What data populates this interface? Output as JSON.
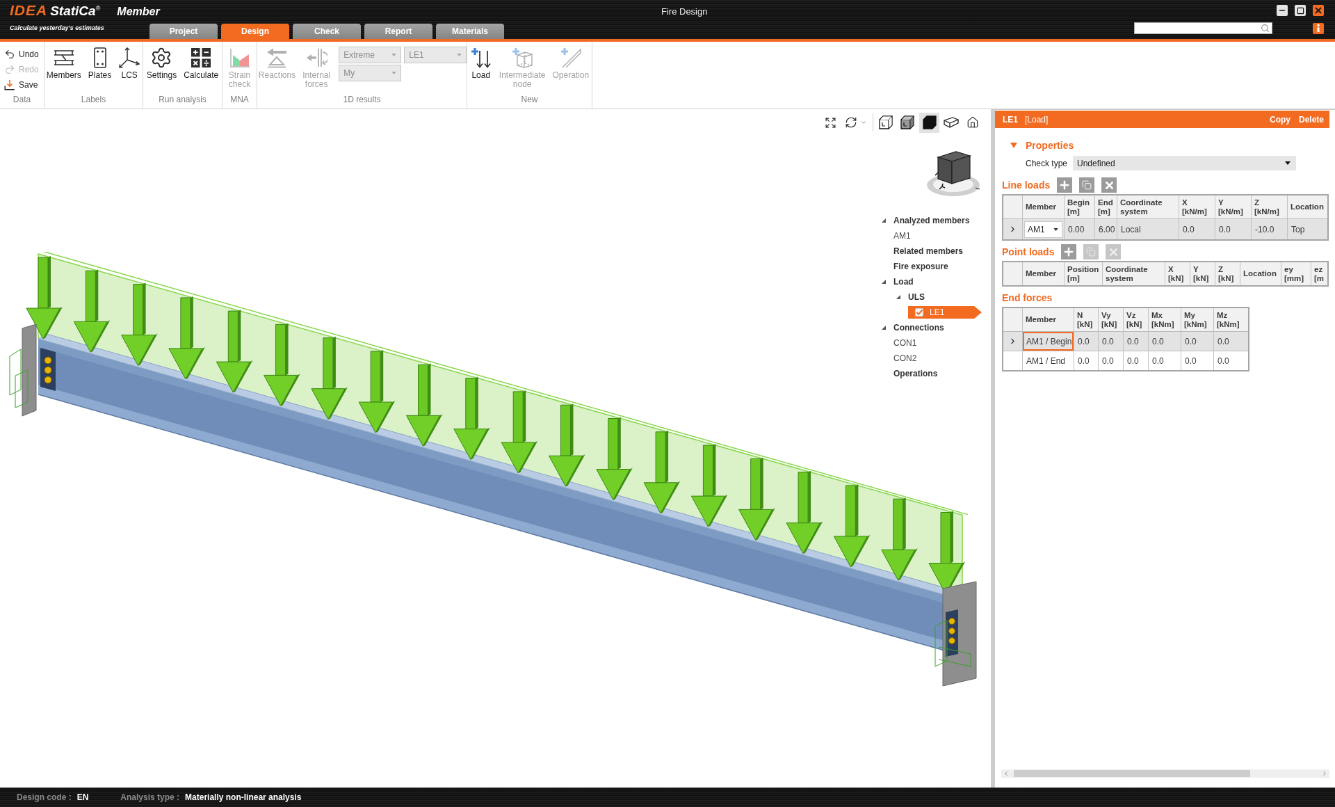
{
  "brand": {
    "mark": "IDEA",
    "name": "StatiCa$^{®}$",
    "product": "Member",
    "tagline": "Calculate yesterday's estimates"
  },
  "window": {
    "title": "Fire Design"
  },
  "tabs": [
    {
      "label": "Project",
      "selected": false
    },
    {
      "label": "Design",
      "selected": true
    },
    {
      "label": "Check",
      "selected": false
    },
    {
      "label": "Report",
      "selected": false
    },
    {
      "label": "Materials",
      "selected": false
    }
  ],
  "ribbon": {
    "groups": [
      {
        "label": "Data",
        "kind": "list",
        "buttons": [
          {
            "kind": "undo",
            "label": "Undo",
            "disabled": false
          },
          {
            "kind": "redo",
            "label": "Redo",
            "disabled": true
          },
          {
            "kind": "save",
            "label": "Save",
            "disabled": false
          }
        ]
      },
      {
        "label": "Labels",
        "kind": "large",
        "buttons": [
          {
            "kind": "members",
            "label": "Members",
            "disabled": false
          },
          {
            "kind": "plates",
            "label": "Plates",
            "disabled": false
          },
          {
            "kind": "lcs",
            "label": "LCS",
            "disabled": false
          }
        ]
      },
      {
        "label": "Run analysis",
        "kind": "large",
        "buttons": [
          {
            "kind": "settings",
            "label": "Settings",
            "disabled": false
          },
          {
            "kind": "calculate",
            "label": "Calculate",
            "disabled": false
          }
        ]
      },
      {
        "label": "MNA",
        "kind": "large",
        "buttons": [
          {
            "kind": "strain",
            "label": "Strain\ncheck",
            "disabled": true
          }
        ]
      },
      {
        "label": "1D results",
        "kind": "large",
        "buttons": [
          {
            "kind": "reactions",
            "label": "Reactions",
            "disabled": true
          },
          {
            "kind": "internal-forces",
            "label": "Internal\nforces",
            "disabled": true
          }
        ],
        "selects": [
          {
            "value": "Extreme",
            "disabled": true
          },
          {
            "value": "LE1",
            "disabled": true
          },
          {
            "value": "My",
            "disabled": true
          }
        ]
      },
      {
        "label": "New",
        "kind": "large",
        "buttons": [
          {
            "kind": "load",
            "label": "Load",
            "disabled": false
          },
          {
            "kind": "node",
            "label": "Intermediate\nnode",
            "disabled": true
          },
          {
            "kind": "operation",
            "label": "Operation",
            "disabled": true
          }
        ]
      }
    ]
  },
  "viewport": {
    "view_tools": [
      {
        "kind": "fit",
        "selected": false
      },
      {
        "kind": "orbit",
        "selected": false
      },
      {
        "kind": "wireframe",
        "selected": false
      },
      {
        "kind": "shaded",
        "selected": false
      },
      {
        "kind": "solid",
        "selected": true
      },
      {
        "kind": "perspective",
        "selected": false
      },
      {
        "kind": "home",
        "selected": false
      }
    ],
    "tree": [
      {
        "label": "Analyzed members",
        "kind": "section",
        "expanded": true,
        "selected": false,
        "children": [
          {
            "label": "AM1",
            "kind": "item",
            "selected": false
          }
        ]
      },
      {
        "label": "Related members",
        "kind": "section",
        "selected": false
      },
      {
        "label": "Fire exposure",
        "kind": "section",
        "selected": false
      },
      {
        "label": "Load",
        "kind": "section",
        "expanded": true,
        "selected": false,
        "children": [
          {
            "label": "ULS",
            "kind": "section",
            "expanded": true,
            "selected": false,
            "children": [
              {
                "label": "LE1",
                "kind": "item",
                "checked": true,
                "selected": true
              }
            ]
          }
        ]
      },
      {
        "label": "Connections",
        "kind": "section",
        "expanded": true,
        "selected": false,
        "children": [
          {
            "label": "CON1",
            "kind": "item",
            "selected": false
          },
          {
            "label": "CON2",
            "kind": "item",
            "selected": false
          }
        ]
      },
      {
        "label": "Operations",
        "kind": "section",
        "selected": false
      }
    ]
  },
  "panel": {
    "header": {
      "name": "LE1",
      "type": "[Load]",
      "actions": [
        "Copy",
        "Delete"
      ]
    },
    "properties": {
      "title": "Properties",
      "expanded": true,
      "check_type": {
        "label": "Check type",
        "value": "Undefined"
      }
    },
    "line_loads": {
      "title": "Line loads",
      "kind": "editable",
      "actions": [
        {
          "kind": "add",
          "disabled": false
        },
        {
          "kind": "copy",
          "disabled": false
        },
        {
          "kind": "delete",
          "disabled": false
        }
      ],
      "columns": [
        "Member",
        "Begin\n[m]",
        "End\n[m]",
        "Coordinate\nsystem",
        "X\n[kN/m]",
        "Y\n[kN/m]",
        "Z\n[kN/m]",
        "Location"
      ],
      "rows": [
        {
          "selected": true,
          "cells": [
            "AM1",
            "0.00",
            "6.00",
            "Local",
            "0.0",
            "0.0",
            "-10.0",
            "Top"
          ]
        }
      ]
    },
    "point_loads": {
      "title": "Point loads",
      "actions": [
        {
          "kind": "add",
          "disabled": false
        },
        {
          "kind": "copy",
          "disabled": true
        },
        {
          "kind": "delete",
          "disabled": true
        }
      ],
      "columns": [
        "Member",
        "Position\n[m]",
        "Coordinate\nsystem",
        "X\n[kN]",
        "Y\n[kN]",
        "Z\n[kN]",
        "Location",
        "ey\n[mm]",
        "ez\n[m"
      ]
    },
    "end_forces": {
      "title": "End forces",
      "kind": "results",
      "columns": [
        "Member",
        "N\n[kN]",
        "Vy\n[kN]",
        "Vz\n[kN]",
        "Mx\n[kNm]",
        "My\n[kNm]",
        "Mz\n[kNm]"
      ],
      "rows": [
        {
          "selected": true,
          "focused": true,
          "cells": [
            "AM1 / Begin",
            "0.0",
            "0.0",
            "0.0",
            "0.0",
            "0.0",
            "0.0"
          ]
        },
        {
          "selected": false,
          "focused": false,
          "cells": [
            "AM1 / End",
            "0.0",
            "0.0",
            "0.0",
            "0.0",
            "0.0",
            "0.0"
          ]
        }
      ]
    }
  },
  "status_bar": {
    "items": [
      {
        "label": "Design code :",
        "value": "EN"
      },
      {
        "label": "Analysis type :",
        "value": "Materially non-linear analysis"
      }
    ]
  }
}
